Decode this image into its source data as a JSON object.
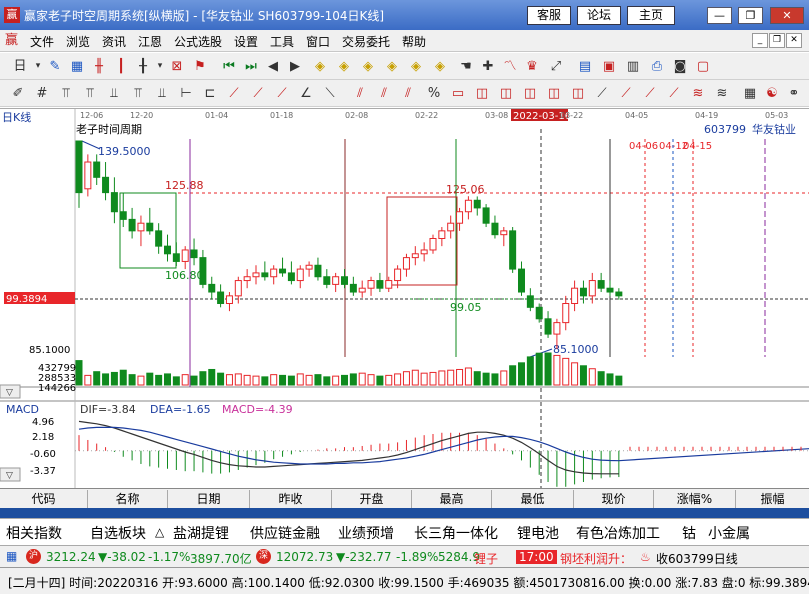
{
  "window": {
    "title": "赢家老子时空周期系统[纵横版] - [华友钴业  SH603799-104日K线]",
    "buttons": {
      "service": "客服",
      "forum": "论坛",
      "home": "主页"
    },
    "controls": {
      "minimize": "—",
      "maximize": "❐",
      "close": "✕"
    }
  },
  "menu": {
    "items": [
      "文件",
      "浏览",
      "资讯",
      "江恩",
      "公式选股",
      "设置",
      "工具",
      "窗口",
      "交易委托",
      "帮助"
    ]
  },
  "toolbar1": {
    "icons": [
      "day-icon",
      "dropdown-icon",
      "note-icon",
      "chart-icon",
      "candle-icon",
      "kline-icon",
      "bar-icon",
      "dropdown-icon",
      "grid-icon",
      "flag-icon",
      "first-icon",
      "prev-icon",
      "back-icon",
      "forward-icon",
      "diamond-icon",
      "diamond-icon",
      "diamond-icon",
      "diamond-icon",
      "diamond-icon",
      "diamond-icon",
      "diamond-icon",
      "hand-icon",
      "cross-icon",
      "line-icon",
      "crown-icon",
      "expand-icon",
      "calendar-icon",
      "date-icon",
      "calc-icon",
      "print-icon",
      "camera-icon"
    ]
  },
  "chart": {
    "period_label": "日K线",
    "indicator_name": "老子时间周期",
    "stock_code": "603799",
    "stock_name": "华友钴业",
    "date_ticks": [
      "12-06",
      "12-20",
      "01-04",
      "01-18",
      "02-08",
      "02-22",
      "03-08",
      "03-22",
      "04-05",
      "04-19",
      "05-03"
    ],
    "cursor_date": "2022-03-16",
    "future_labels": [
      "04-06",
      "04-12",
      "04-15"
    ],
    "price_annotations": {
      "high": "139.5000",
      "p125a": "125.88",
      "p106": "106.80",
      "p125b": "125.06",
      "p99": "99.05",
      "low": "85.1000"
    },
    "current_price": "99.3894",
    "axis_low": "85.1000",
    "vol_ticks": [
      "432799",
      "288533",
      "144266"
    ],
    "macd_name": "MACD",
    "macd_values": {
      "dif": "DIF=-3.84",
      "dea": "DEA=-1.65",
      "macd": "MACD=-4.39"
    },
    "macd_ticks": [
      "4.96",
      "2.18",
      "-0.60",
      "-3.37"
    ],
    "colors": {
      "up": "#e8262a",
      "down": "#0f8a1e",
      "dif": "#333333",
      "dea": "#1a3c9e",
      "macd": "#c8309a",
      "grid": "#a8a8a8"
    }
  },
  "chart_data": {
    "type": "candlestick",
    "title": "",
    "candles": [
      [
        139.5,
        139.5,
        122.0,
        126.0
      ],
      [
        127.0,
        136.0,
        125.0,
        134.0
      ],
      [
        134.0,
        136.0,
        128.0,
        130.0
      ],
      [
        130.0,
        134.0,
        124.0,
        126.0
      ],
      [
        126.0,
        130.0,
        118.0,
        121.0
      ],
      [
        121.0,
        126.0,
        117.0,
        119.0
      ],
      [
        119.0,
        122.0,
        114.0,
        116.0
      ],
      [
        116.0,
        120.0,
        112.0,
        118.0
      ],
      [
        118.0,
        122.0,
        115.0,
        116.0
      ],
      [
        116.0,
        118.0,
        110.0,
        112.0
      ],
      [
        112.0,
        115.0,
        108.0,
        110.0
      ],
      [
        110.0,
        113.0,
        106.8,
        108.0
      ],
      [
        108.0,
        112.0,
        106.0,
        111.0
      ],
      [
        111.0,
        114.0,
        107.0,
        109.0
      ],
      [
        109.0,
        111.0,
        101.0,
        102.0
      ],
      [
        102.0,
        104.0,
        98.0,
        100.0
      ],
      [
        100.0,
        102.0,
        96.0,
        97.0
      ],
      [
        97.0,
        100.0,
        95.0,
        99.0
      ],
      [
        99.0,
        104.0,
        97.0,
        103.0
      ],
      [
        103.0,
        106.0,
        101.0,
        104.0
      ],
      [
        104.0,
        107.0,
        102.0,
        105.0
      ],
      [
        105.0,
        108.0,
        103.0,
        104.0
      ],
      [
        104.0,
        107.0,
        102.0,
        106.0
      ],
      [
        106.0,
        109.0,
        104.0,
        105.0
      ],
      [
        105.0,
        108.0,
        102.0,
        103.0
      ],
      [
        103.0,
        107.0,
        101.0,
        106.0
      ],
      [
        106.0,
        108.0,
        104.0,
        107.0
      ],
      [
        107.0,
        109.0,
        103.0,
        104.0
      ],
      [
        104.0,
        106.0,
        101.0,
        102.0
      ],
      [
        102.0,
        105.0,
        100.0,
        104.0
      ],
      [
        104.0,
        106.0,
        101.0,
        102.0
      ],
      [
        102.0,
        104.0,
        99.0,
        100.0
      ],
      [
        100.0,
        103.0,
        98.5,
        101.0
      ],
      [
        101.0,
        104.0,
        99.0,
        103.0
      ],
      [
        103.0,
        105.0,
        100.0,
        101.0
      ],
      [
        101.0,
        104.0,
        100.0,
        103.0
      ],
      [
        103.0,
        107.0,
        101.0,
        106.0
      ],
      [
        106.0,
        110.0,
        104.0,
        109.0
      ],
      [
        109.0,
        112.0,
        107.0,
        110.0
      ],
      [
        110.0,
        113.0,
        108.0,
        111.0
      ],
      [
        111.0,
        115.0,
        110.0,
        114.0
      ],
      [
        114.0,
        117.0,
        112.0,
        116.0
      ],
      [
        116.0,
        120.0,
        114.0,
        118.0
      ],
      [
        118.0,
        122.0,
        116.0,
        121.0
      ],
      [
        121.0,
        125.06,
        119.0,
        124.0
      ],
      [
        124.0,
        125.0,
        120.0,
        122.0
      ],
      [
        122.0,
        123.0,
        117.0,
        118.0
      ],
      [
        118.0,
        120.0,
        114.0,
        115.0
      ],
      [
        115.0,
        117.0,
        112.0,
        116.0
      ],
      [
        116.0,
        117.0,
        105.0,
        106.0
      ],
      [
        106.0,
        108.0,
        99.0,
        100.0
      ],
      [
        99.0,
        101.0,
        95.0,
        96.0
      ],
      [
        96.0,
        97.0,
        92.0,
        93.0
      ],
      [
        93.0,
        95.0,
        88.0,
        89.0
      ],
      [
        89.0,
        93.0,
        85.1,
        92.0
      ],
      [
        92.0,
        99.0,
        90.0,
        97.0
      ],
      [
        97.0,
        103.0,
        95.0,
        101.0
      ],
      [
        101.0,
        103.0,
        97.0,
        99.0
      ],
      [
        99.0,
        105.0,
        97.0,
        103.0
      ],
      [
        103.0,
        105.0,
        100.0,
        101.0
      ],
      [
        101.0,
        103.0,
        99.0,
        100.0
      ],
      [
        100.0,
        101.0,
        98.0,
        99.0
      ]
    ],
    "volume": [
      330000,
      130000,
      180000,
      150000,
      170000,
      200000,
      140000,
      120000,
      160000,
      130000,
      150000,
      110000,
      140000,
      120000,
      180000,
      210000,
      160000,
      140000,
      150000,
      130000,
      120000,
      110000,
      140000,
      130000,
      120000,
      150000,
      130000,
      140000,
      110000,
      120000,
      130000,
      150000,
      160000,
      140000,
      120000,
      130000,
      150000,
      180000,
      200000,
      160000,
      170000,
      190000,
      200000,
      210000,
      230000,
      180000,
      160000,
      150000,
      190000,
      260000,
      300000,
      380000,
      430000,
      432799,
      400000,
      360000,
      300000,
      260000,
      220000,
      180000,
      150000,
      120000
    ],
    "macd_dif": [
      4.9,
      4.7,
      4.5,
      4.2,
      3.8,
      3.3,
      2.8,
      2.3,
      1.8,
      1.3,
      0.8,
      0.3,
      -0.2,
      -0.6,
      -1.1,
      -1.6,
      -2.0,
      -2.3,
      -2.5,
      -2.6,
      -2.7,
      -2.7,
      -2.6,
      -2.5,
      -2.4,
      -2.3,
      -2.2,
      -2.1,
      -2.0,
      -1.9,
      -1.8,
      -1.7,
      -1.6,
      -1.4,
      -1.2,
      -1.0,
      -0.7,
      -0.3,
      0.2,
      0.7,
      1.2,
      1.7,
      2.1,
      2.5,
      2.9,
      3.1,
      3.1,
      2.9,
      2.6,
      2.1,
      1.4,
      0.5,
      -0.5,
      -1.6,
      -2.6,
      -3.2,
      -3.5,
      -3.7,
      -3.8,
      -3.84,
      -3.84,
      -3.84
    ],
    "macd_dea": [
      3.6,
      3.8,
      3.9,
      3.9,
      3.9,
      3.8,
      3.6,
      3.4,
      3.1,
      2.7,
      2.3,
      1.9,
      1.5,
      1.1,
      0.7,
      0.3,
      -0.1,
      -0.5,
      -0.9,
      -1.2,
      -1.5,
      -1.7,
      -1.9,
      -2.0,
      -2.1,
      -2.2,
      -2.2,
      -2.2,
      -2.2,
      -2.1,
      -2.1,
      -2.0,
      -2.0,
      -1.9,
      -1.8,
      -1.6,
      -1.4,
      -1.2,
      -0.9,
      -0.6,
      -0.2,
      0.2,
      0.6,
      1.0,
      1.4,
      1.8,
      2.1,
      2.3,
      2.4,
      2.4,
      2.2,
      1.9,
      1.5,
      1.0,
      0.4,
      -0.2,
      -0.7,
      -1.1,
      -1.4,
      -1.55,
      -1.62,
      -1.65
    ],
    "ylim_price": [
      85.1,
      139.5
    ]
  },
  "quote_table": {
    "headers": [
      "代码",
      "名称",
      "日期",
      "昨收",
      "开盘",
      "最高",
      "最低",
      "现价",
      "涨幅%",
      "振幅"
    ],
    "row": [
      "",
      "",
      "",
      "",
      "",
      "",
      "",
      "",
      "",
      ""
    ]
  },
  "sectors": [
    "相关指数",
    "自选板块",
    "盐湖提锂",
    "供应链金融",
    "业绩预增",
    "长三角一体化",
    "锂电池",
    "有色冶炼加工",
    "钴",
    "小金属"
  ],
  "index_bar": {
    "sh_value": "3212.24",
    "sh_change": "▼-38.02",
    "sh_pct": "-1.17%",
    "sh_amount": "3897.70亿",
    "sz_value": "12072.73",
    "sz_change": "▼-232.77",
    "sz_pct": "-1.89%",
    "sz_amount": "5284.9",
    "scroll1": "锂子",
    "time": "17:00",
    "scroll2": "钢坯利润升：",
    "watch": "收603799日线"
  },
  "status": {
    "text": "[二月十四] 时间:20220316 开:93.6000 高:100.1400 低:92.0300 收:99.1500 手:469035 额:4501730816.00 换:0.00 涨:7.83 盘:0 标:99.3894"
  }
}
